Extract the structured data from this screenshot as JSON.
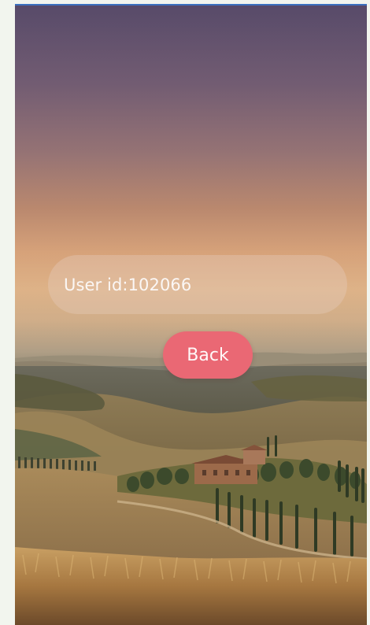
{
  "screen": {
    "background_desc": "Tuscany countryside at sunset"
  },
  "user": {
    "label": "User id:102066"
  },
  "actions": {
    "back_label": "Back"
  },
  "colors": {
    "back_button": "#ea6874",
    "top_accent": "#3a76c9",
    "input_bg": "rgba(230,205,190,0.36)"
  }
}
